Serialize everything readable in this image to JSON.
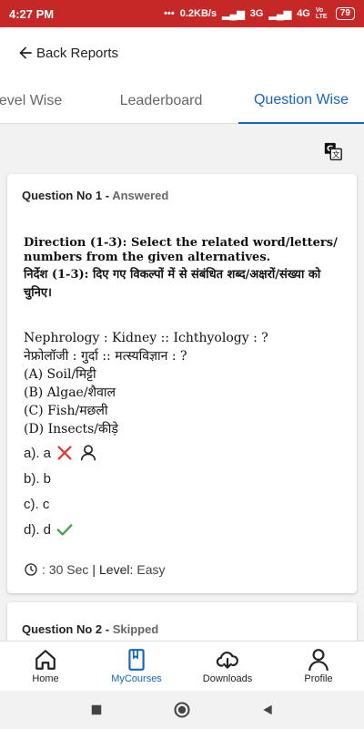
{
  "status_bar": {
    "time": "4:27 PM",
    "speed": "0.2KB/s",
    "network1": "3G",
    "network2": "4G",
    "volte": "Vo LTE",
    "battery": "79"
  },
  "header": {
    "back_label": "Back Reports"
  },
  "tabs": [
    "Level Wise",
    "Leaderboard",
    "Question Wise"
  ],
  "questions": [
    {
      "title": "Question No 1",
      "sep": " - ",
      "status": "Answered",
      "direction_en": "Direction (1-3): Select the related word/letters/ numbers from the given alternatives.",
      "direction_hi": "निर्देश (1-3): दिए गए विकल्पों में से संबंधित शब्द/अक्षरों/संख्या को चुनिए।",
      "question_en": "Nephrology : Kidney :: Ichthyology : ?",
      "question_hi": "नेफ्रोलॉजी : गुर्दा :: मत्स्यविज्ञान : ?",
      "choices": [
        "(A) Soil/मिट्टी",
        "(B) Algae/शैवाल",
        "(C) Fish/मछली",
        "(D) Insects/कीड़े"
      ],
      "options": [
        "a). a",
        "b). b",
        "c). c",
        "d). d"
      ],
      "time": ": 30 Sec",
      "divider": "|",
      "level_label": "Level:",
      "level_value": "Easy"
    },
    {
      "title": "Question No 2",
      "sep": " - ",
      "status": "Skipped"
    }
  ],
  "bottom_nav": [
    "Home",
    "MyCourses",
    "Downloads",
    "Profile"
  ],
  "colors": {
    "accent": "#1565c0",
    "wrong": "#e53935",
    "correct": "#43a047",
    "status_bar": "#c62828"
  }
}
